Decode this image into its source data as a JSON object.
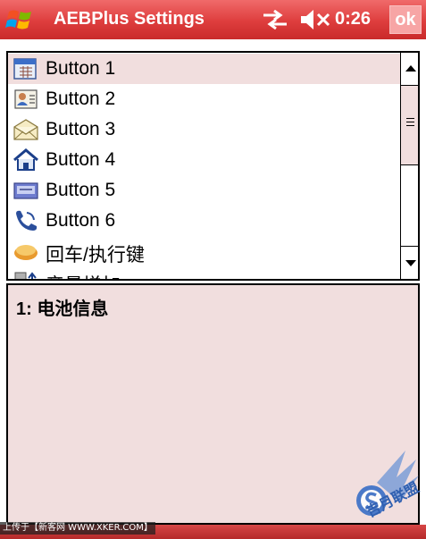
{
  "titlebar": {
    "title": "AEBPlus Settings",
    "clock": "0:26",
    "ok_label": "ok"
  },
  "list": {
    "selected_index": 0,
    "items": [
      {
        "label": "Button 1",
        "icon": "calendar-icon"
      },
      {
        "label": "Button 2",
        "icon": "contacts-icon"
      },
      {
        "label": "Button 3",
        "icon": "envelope-icon"
      },
      {
        "label": "Button 4",
        "icon": "home-icon"
      },
      {
        "label": "Button 5",
        "icon": "keyboard-icon"
      },
      {
        "label": "Button 6",
        "icon": "phone-icon"
      },
      {
        "label": "回车/执行键",
        "icon": "enter-key-icon"
      },
      {
        "label": "音量增加",
        "icon": "volume-up-icon"
      }
    ]
  },
  "description": {
    "text": "1: 电池信息"
  },
  "watermark": {
    "caption": "上传于【新客网 WWW.XKER.COM】",
    "logo_text": "吉月联盟"
  },
  "colors": {
    "titlebar": "#de3d3d",
    "selection": "#f1dede",
    "panel_bg": "#f1dede",
    "ok_button": "#f7a5a5"
  }
}
